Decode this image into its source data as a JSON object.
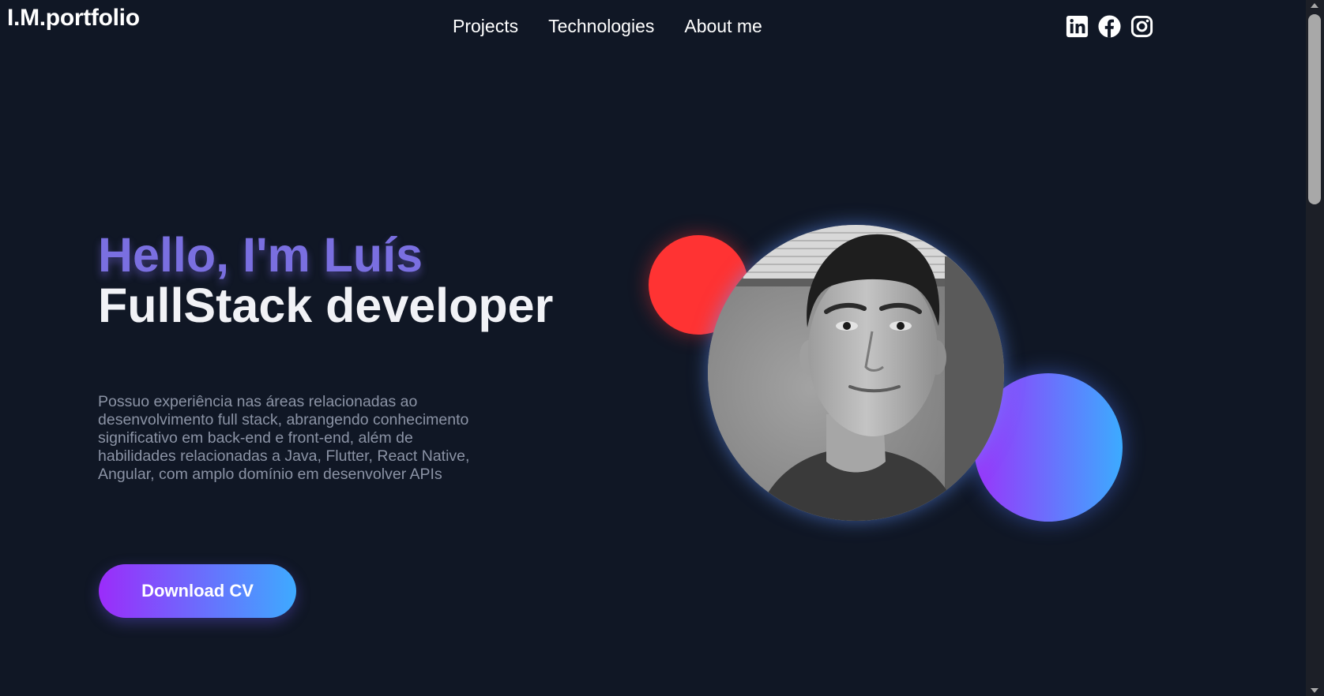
{
  "header": {
    "logo": "I.M.portfolio",
    "nav": [
      {
        "label": "Projects"
      },
      {
        "label": "Technologies"
      },
      {
        "label": "About me"
      }
    ],
    "socials": [
      {
        "icon": "linkedin-icon"
      },
      {
        "icon": "facebook-icon"
      },
      {
        "icon": "instagram-icon"
      }
    ]
  },
  "hero": {
    "greeting": "Hello, I'm Luís",
    "role": "FullStack developer",
    "description": "Possuo experiência nas áreas relacionadas ao desenvolvimento full stack, abrangendo conhecimento significativo em back-end e front-end, além de habilidades relacionadas a Java, Flutter, React Native, Angular, com amplo domínio em desenvolver APIs",
    "button_label": "Download CV"
  },
  "colors": {
    "background": "#101725",
    "greeting": "#7a6fe0",
    "accent_red": "#ff3333",
    "gradient_start": "#9b2cfa",
    "gradient_end": "#3eaaff",
    "description_text": "#8b93a5"
  }
}
